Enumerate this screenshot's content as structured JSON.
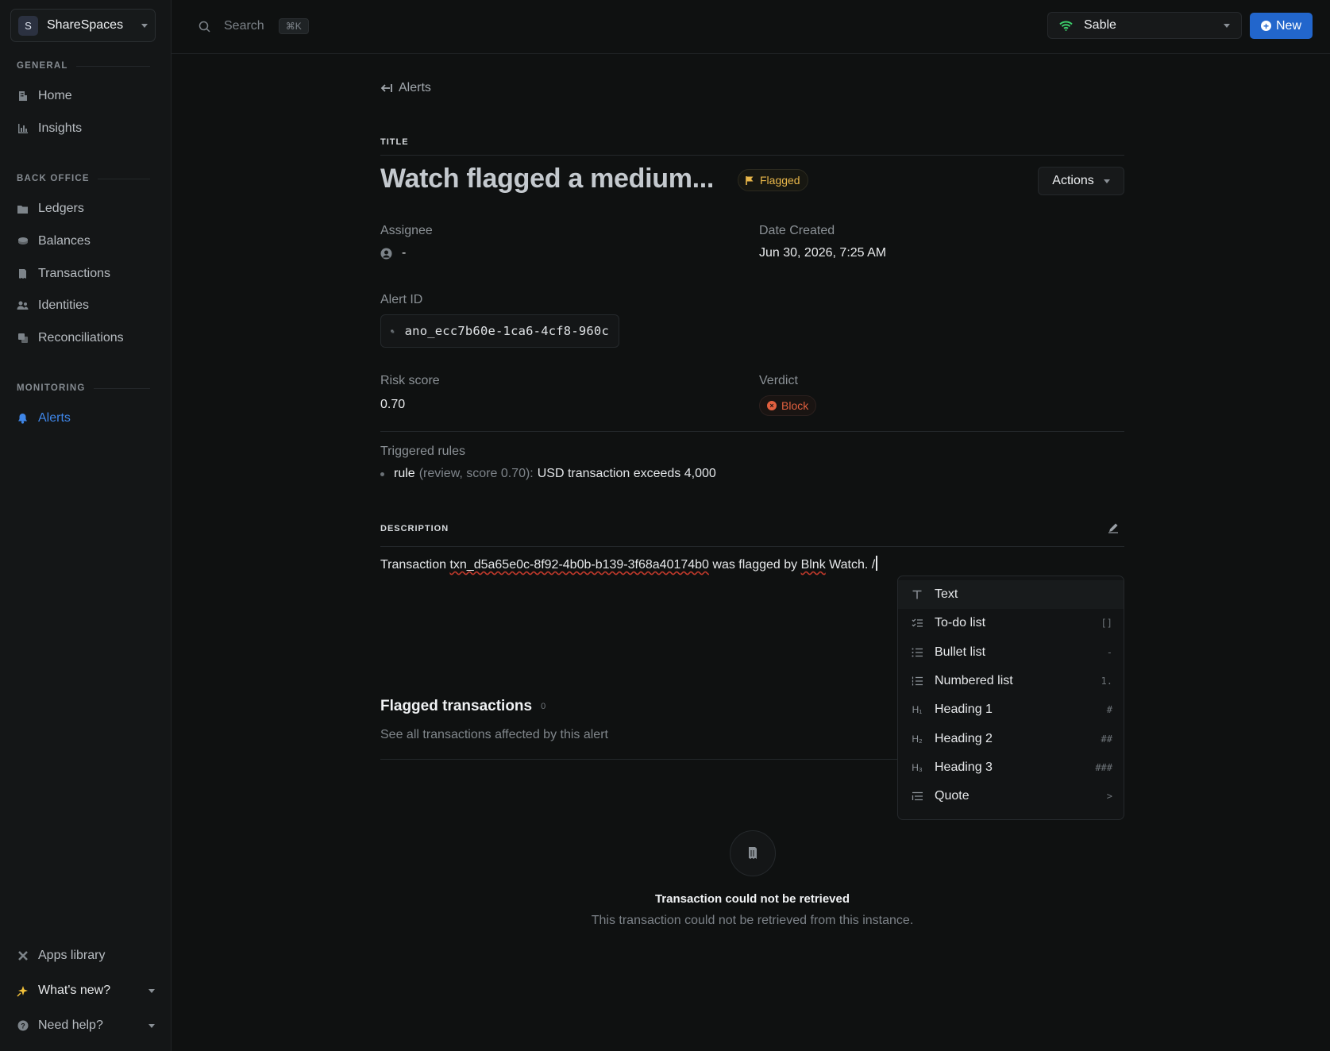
{
  "workspace": {
    "initial": "S",
    "name": "ShareSpaces"
  },
  "sidebar": {
    "groups": [
      {
        "label": "GENERAL",
        "items": [
          {
            "label": "Home",
            "icon": "building-icon"
          },
          {
            "label": "Insights",
            "icon": "chart-bar-icon"
          }
        ]
      },
      {
        "label": "BACK OFFICE",
        "items": [
          {
            "label": "Ledgers",
            "icon": "folder-icon"
          },
          {
            "label": "Balances",
            "icon": "coins-icon"
          },
          {
            "label": "Transactions",
            "icon": "receipt-icon"
          },
          {
            "label": "Identities",
            "icon": "users-icon"
          },
          {
            "label": "Reconciliations",
            "icon": "copy-icon"
          }
        ]
      },
      {
        "label": "MONITORING",
        "items": [
          {
            "label": "Alerts",
            "icon": "bell-icon",
            "active": true
          }
        ]
      }
    ],
    "footer": [
      {
        "label": "Apps library",
        "icon": "apps-icon"
      },
      {
        "label": "What's new?",
        "icon": "sparkle-icon"
      },
      {
        "label": "Need help?",
        "icon": "help-circle-icon"
      }
    ]
  },
  "topbar": {
    "search_placeholder": "Search",
    "search_shortcut": "⌘K",
    "environment": "Sable",
    "new_label": "New"
  },
  "alert": {
    "back_label": "Alerts",
    "title_section_label": "TITLE",
    "title": "Watch flagged a medium...",
    "status": "Flagged",
    "actions_label": "Actions",
    "assignee_label": "Assignee",
    "assignee_value": "-",
    "date_created_label": "Date Created",
    "date_created_value": "Jun 30, 2026, 7:25 AM",
    "alert_id_label": "Alert ID",
    "alert_id_value": "ano_ecc7b60e-1ca6-4cf8-960c",
    "risk_score_label": "Risk score",
    "risk_score_value": "0.70",
    "verdict_label": "Verdict",
    "verdict_value": "Block",
    "triggered_rules_label": "Triggered rules",
    "rule": {
      "name": "rule",
      "meta": "(review, score 0.70):",
      "description": "USD transaction exceeds 4,000"
    },
    "description_section_label": "DESCRIPTION",
    "description": {
      "prefix": "Transaction ",
      "txn_id": "txn_d5a65e0c-8f92-4b0b-b139-3f68a40174b0",
      "middle": " was flagged by ",
      "brand": "Blnk",
      "suffix": " Watch. /"
    },
    "flagged_transactions": {
      "title": "Flagged transactions",
      "count": "0",
      "subtitle": "See all transactions affected by this alert",
      "empty_title": "Transaction could not be retrieved",
      "empty_subtitle": "This transaction could not be retrieved from this instance."
    }
  },
  "slash_menu": {
    "items": [
      {
        "label": "Text",
        "shortcut": "",
        "icon": "text-type-icon"
      },
      {
        "label": "To-do list",
        "shortcut": "[]",
        "icon": "checklist-icon"
      },
      {
        "label": "Bullet list",
        "shortcut": "-",
        "icon": "list-icon"
      },
      {
        "label": "Numbered list",
        "shortcut": "1.",
        "icon": "numbered-list-icon"
      },
      {
        "label": "Heading 1",
        "shortcut": "#",
        "icon": "h1-icon",
        "glyph": "H₁"
      },
      {
        "label": "Heading 2",
        "shortcut": "##",
        "icon": "h2-icon",
        "glyph": "H₂"
      },
      {
        "label": "Heading 3",
        "shortcut": "###",
        "icon": "h3-icon",
        "glyph": "H₃"
      },
      {
        "label": "Quote",
        "shortcut": ">",
        "icon": "quote-icon"
      }
    ]
  },
  "colors": {
    "accent": "#2266cc",
    "active_nav": "#3f86e8",
    "flagged": "#e9b74a",
    "block": "#e2603f",
    "env_indicator": "#3ccf6b"
  }
}
